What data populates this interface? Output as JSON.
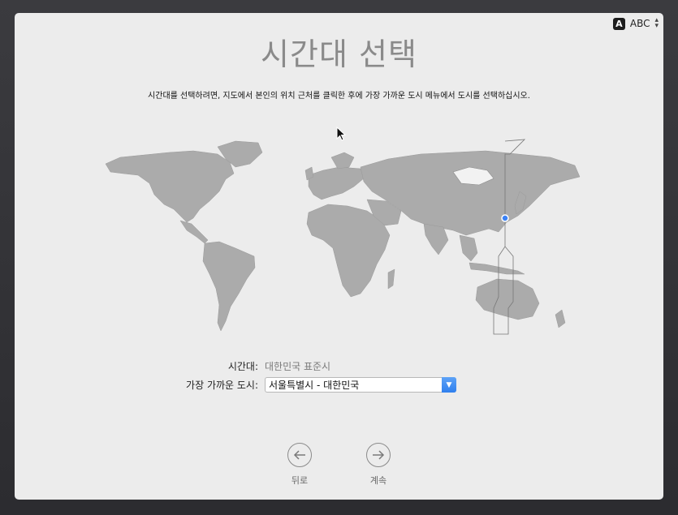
{
  "input_menu": {
    "badge": "A",
    "label": "ABC",
    "arrows": "⌃⌄"
  },
  "title": "시간대 선택",
  "instructions": "시간대를 선택하려면, 지도에서 본인의 위치 근처를 클릭한 후에 가장 가까운 도시 메뉴에서 도시를 선택하십시오.",
  "timezone": {
    "label": "시간대:",
    "value": "대한민국 표준시"
  },
  "closest_city": {
    "label": "가장 가까운 도시:",
    "value": "서울특별시 - 대한민국"
  },
  "nav": {
    "back_label": "뒤로",
    "continue_label": "계속"
  },
  "colors": {
    "land": "#ababab",
    "selected_zone": "#ffffff",
    "pin": "#3b82f6",
    "accent": "#2f7fee"
  }
}
